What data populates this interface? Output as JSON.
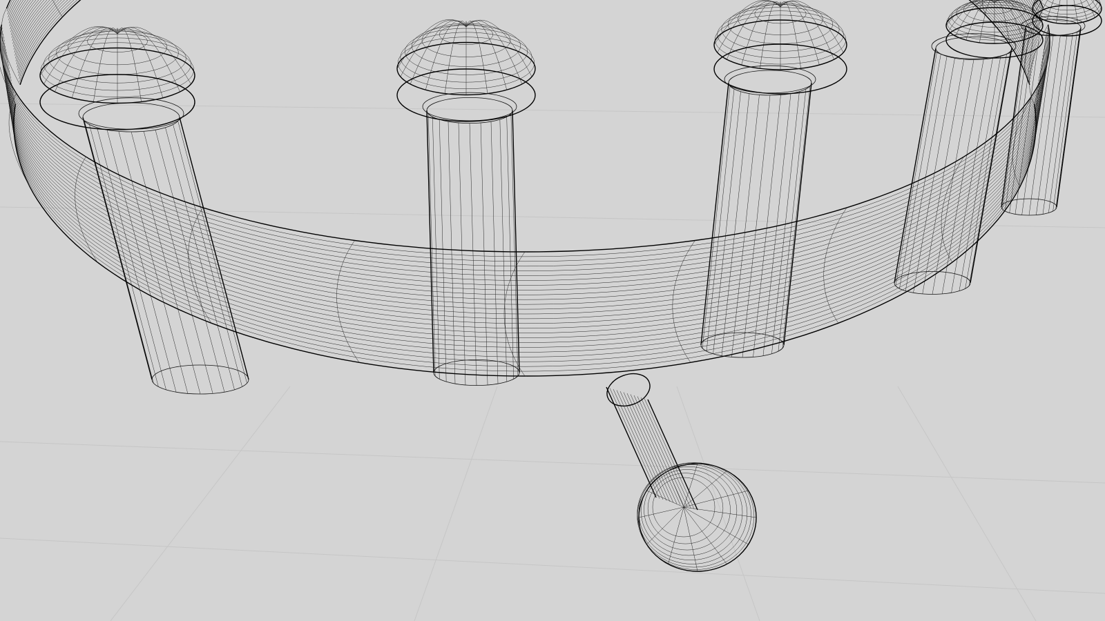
{
  "viewport": {
    "background_color": "#d4d4d4",
    "wire_color": "#111111",
    "grid_color": "#c6c6c6",
    "render_mode": "wireframe"
  },
  "objects": [
    {
      "name": "ring-torus",
      "icon": "torus-mesh"
    },
    {
      "name": "pin-1",
      "icon": "pin-mesh"
    },
    {
      "name": "pin-2",
      "icon": "pin-mesh"
    },
    {
      "name": "pin-3",
      "icon": "pin-mesh"
    },
    {
      "name": "pin-4",
      "icon": "pin-mesh"
    },
    {
      "name": "pin-5",
      "icon": "pin-mesh"
    },
    {
      "name": "pin-loose",
      "icon": "pin-mesh"
    }
  ]
}
